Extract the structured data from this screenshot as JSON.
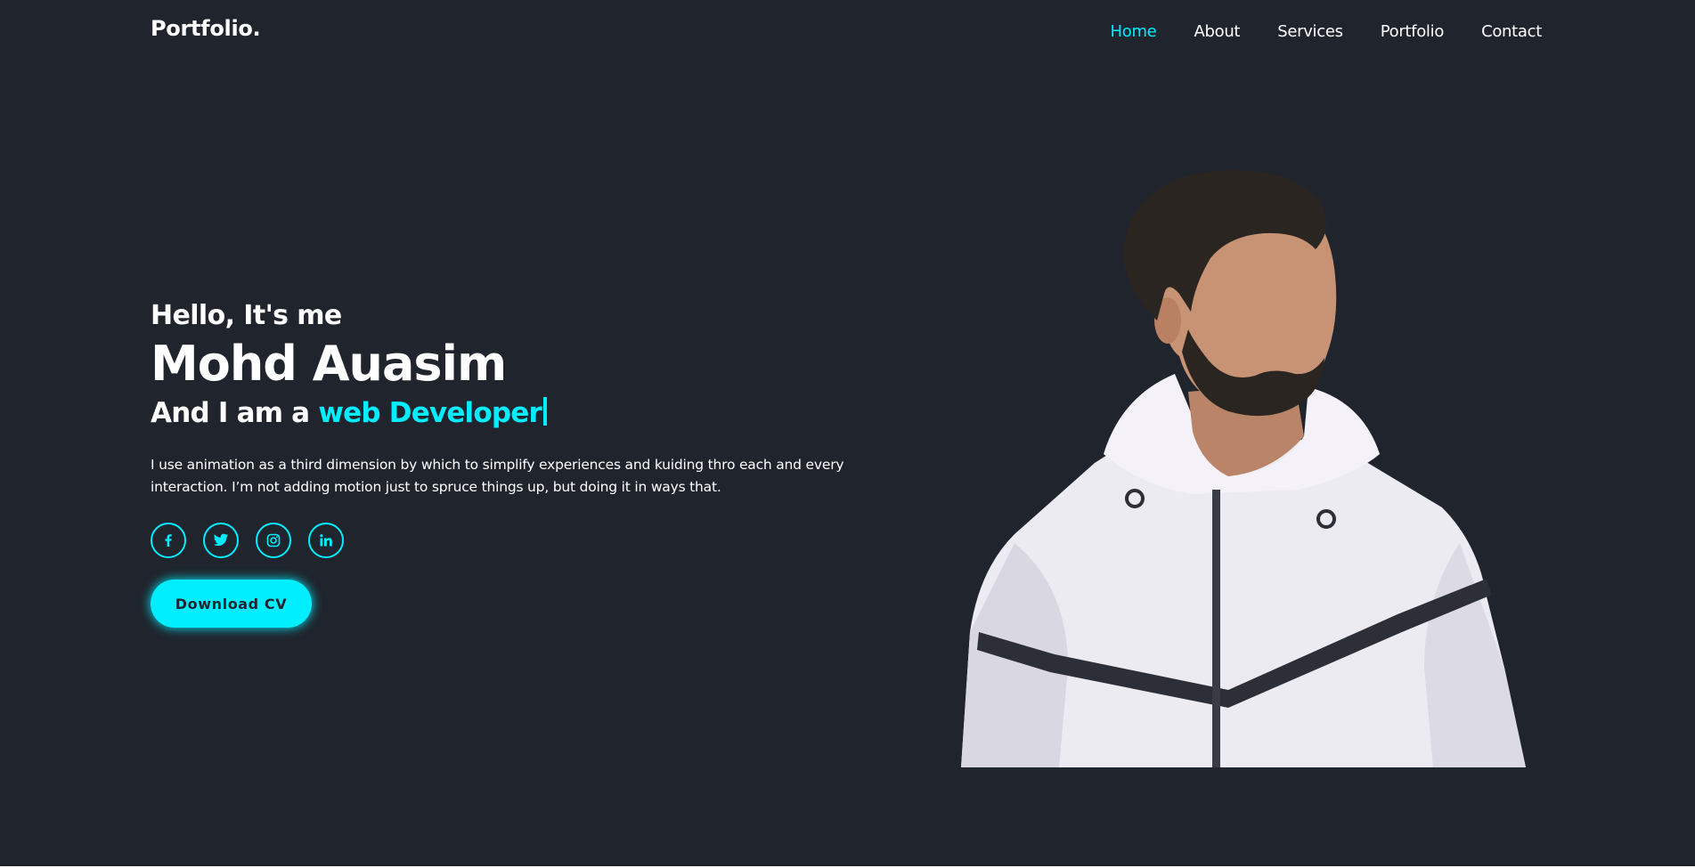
{
  "header": {
    "logo": "Portfolio.",
    "nav": [
      {
        "label": "Home",
        "active": true
      },
      {
        "label": "About",
        "active": false
      },
      {
        "label": "Services",
        "active": false
      },
      {
        "label": "Portfolio",
        "active": false
      },
      {
        "label": "Contact",
        "active": false
      }
    ]
  },
  "hero": {
    "greeting": "Hello, It's me",
    "name": "Mohd Auasim",
    "role_prefix": "And I am a",
    "role": "web Developer",
    "intro": "I use animation as a third dimension by which to simplify experiences and kuiding thro each and every interaction. I’m not adding motion just to spruce things up, but doing it in ways that.",
    "socials": [
      {
        "name": "facebook-icon",
        "glyph": "f"
      },
      {
        "name": "twitter-icon"
      },
      {
        "name": "instagram-icon"
      },
      {
        "name": "linkedin-icon",
        "glyph": "in"
      }
    ],
    "cta_label": "Download CV"
  },
  "colors": {
    "background": "#1f242d",
    "accent": "#00eeff",
    "text": "#ffffff",
    "jacket": "#ecebf2",
    "skin": "#c89375",
    "hair": "#2b2521"
  }
}
